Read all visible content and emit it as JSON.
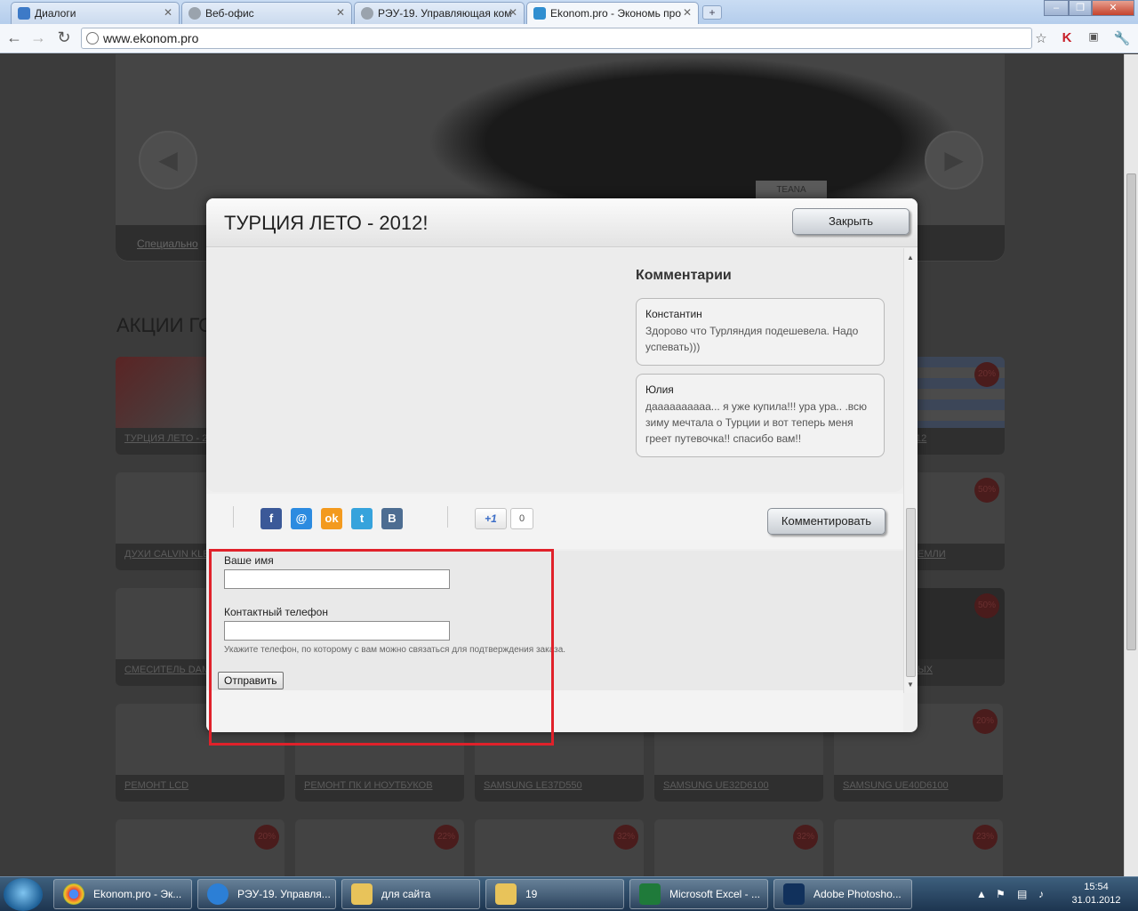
{
  "browser": {
    "tabs": [
      {
        "title": "Диалоги",
        "active": false
      },
      {
        "title": "Веб-офис",
        "active": false
      },
      {
        "title": "РЭУ-19. Управляющая ком",
        "active": false
      },
      {
        "title": "Ekonom.pro - Экономь про",
        "active": true
      }
    ],
    "new_tab_label": "+",
    "url": "www.ekonom.pro"
  },
  "page": {
    "slider_link": "Специально",
    "car_badge": "TEANA",
    "section_title": "АКЦИИ ГОР",
    "cards": [
      {
        "label": "ТУРЦИЯ ЛЕТО - 20",
        "discount": ""
      },
      {
        "label": "ДУХИ CALVIN KLE",
        "discount": ""
      },
      {
        "label": "СМЕСИТЕЛЬ DAM",
        "discount": ""
      },
      {
        "label": "РЕМОНТ LCD",
        "discount": ""
      },
      {
        "label": "РЕМОНТ ПК И НОУТБУКОВ",
        "discount": ""
      },
      {
        "label": "SAMSUNG LE37D550",
        "discount": ""
      },
      {
        "label": "SAMSUNG UE32D6100",
        "discount": ""
      },
      {
        "label": "SAMSUNG UE40D6100",
        "discount": "20%"
      },
      {
        "label": "12",
        "discount": "20%"
      },
      {
        "label": "ЕМЛИ",
        "discount": "50%"
      },
      {
        "label": "ЫХ",
        "discount": "50%"
      },
      {
        "label": "",
        "discount": "20%"
      },
      {
        "label": "",
        "discount": "22%"
      },
      {
        "label": "",
        "discount": "32%"
      },
      {
        "label": "",
        "discount": "32%"
      },
      {
        "label": "",
        "discount": "23%"
      }
    ]
  },
  "modal": {
    "title": "ТУРЦИЯ ЛЕТО - 2012!",
    "close_label": "Закрыть",
    "comments_title": "Комментарии",
    "comments": [
      {
        "author": "Константин",
        "text": "Здорово что Турляндия подешевела. Надо успевать)))"
      },
      {
        "author": "Юлия",
        "text": "даааааааааа... я уже купила!!! ура ура.. .всю зиму мечтала о Турции и вот теперь меня греет путевочка!! спасибо вам!!"
      }
    ],
    "share": {
      "icons": [
        "facebook-icon",
        "mail-ru-icon",
        "odnoklassniki-icon",
        "twitter-icon",
        "vkontakte-icon"
      ],
      "plusone_label": "+1",
      "plusone_count": "0"
    },
    "comment_button_label": "Комментировать",
    "form": {
      "name_label": "Ваше имя",
      "name_value": "",
      "phone_label": "Контактный телефон",
      "phone_value": "",
      "hint": "Укажите телефон, по которому с вам можно связаться для подтверждения заказа.",
      "submit_label": "Отправить"
    },
    "highlight_color": "#e0212a"
  },
  "taskbar": {
    "tasks": [
      {
        "label": "Ekonom.pro - Эк...",
        "icon": "chrome-icon"
      },
      {
        "label": "РЭУ-19. Управля...",
        "icon": "ie-icon"
      },
      {
        "label": "для сайта",
        "icon": "folder-icon"
      },
      {
        "label": "19",
        "icon": "folder-icon"
      },
      {
        "label": "Microsoft Excel - ...",
        "icon": "excel-icon"
      },
      {
        "label": "Adobe Photosho...",
        "icon": "photoshop-icon"
      }
    ],
    "time": "15:54",
    "date": "31.01.2012"
  }
}
